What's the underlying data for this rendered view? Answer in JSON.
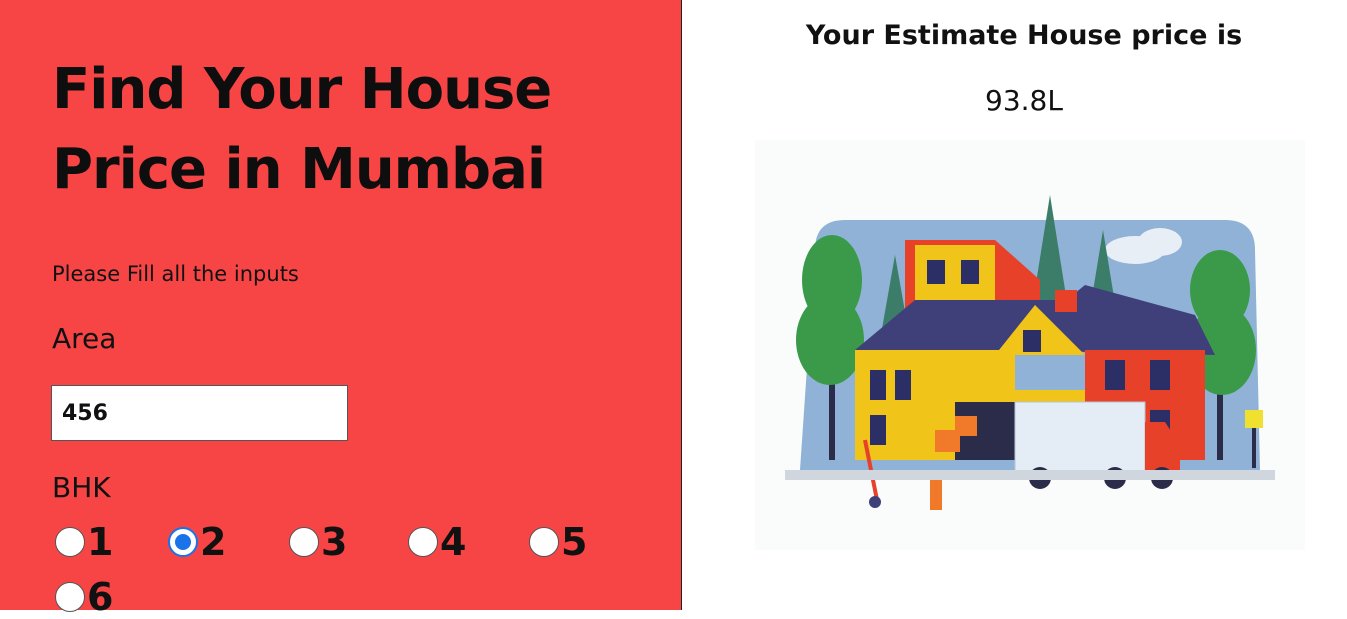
{
  "form": {
    "title": "Find Your House Price in Mumbai",
    "hint": "Please Fill all the inputs",
    "area_label": "Area",
    "area_value": "456",
    "bhk_label": "BHK",
    "bhk_options": [
      "1",
      "2",
      "3",
      "4",
      "5",
      "6"
    ],
    "bhk_selected": "2"
  },
  "result": {
    "heading": "Your Estimate House price is",
    "value": "93.8L"
  },
  "colors": {
    "panel_bg": "#f74545",
    "radio_selected": "#1a73e8"
  },
  "illustration": {
    "name": "house-with-moving-truck-illustration"
  }
}
